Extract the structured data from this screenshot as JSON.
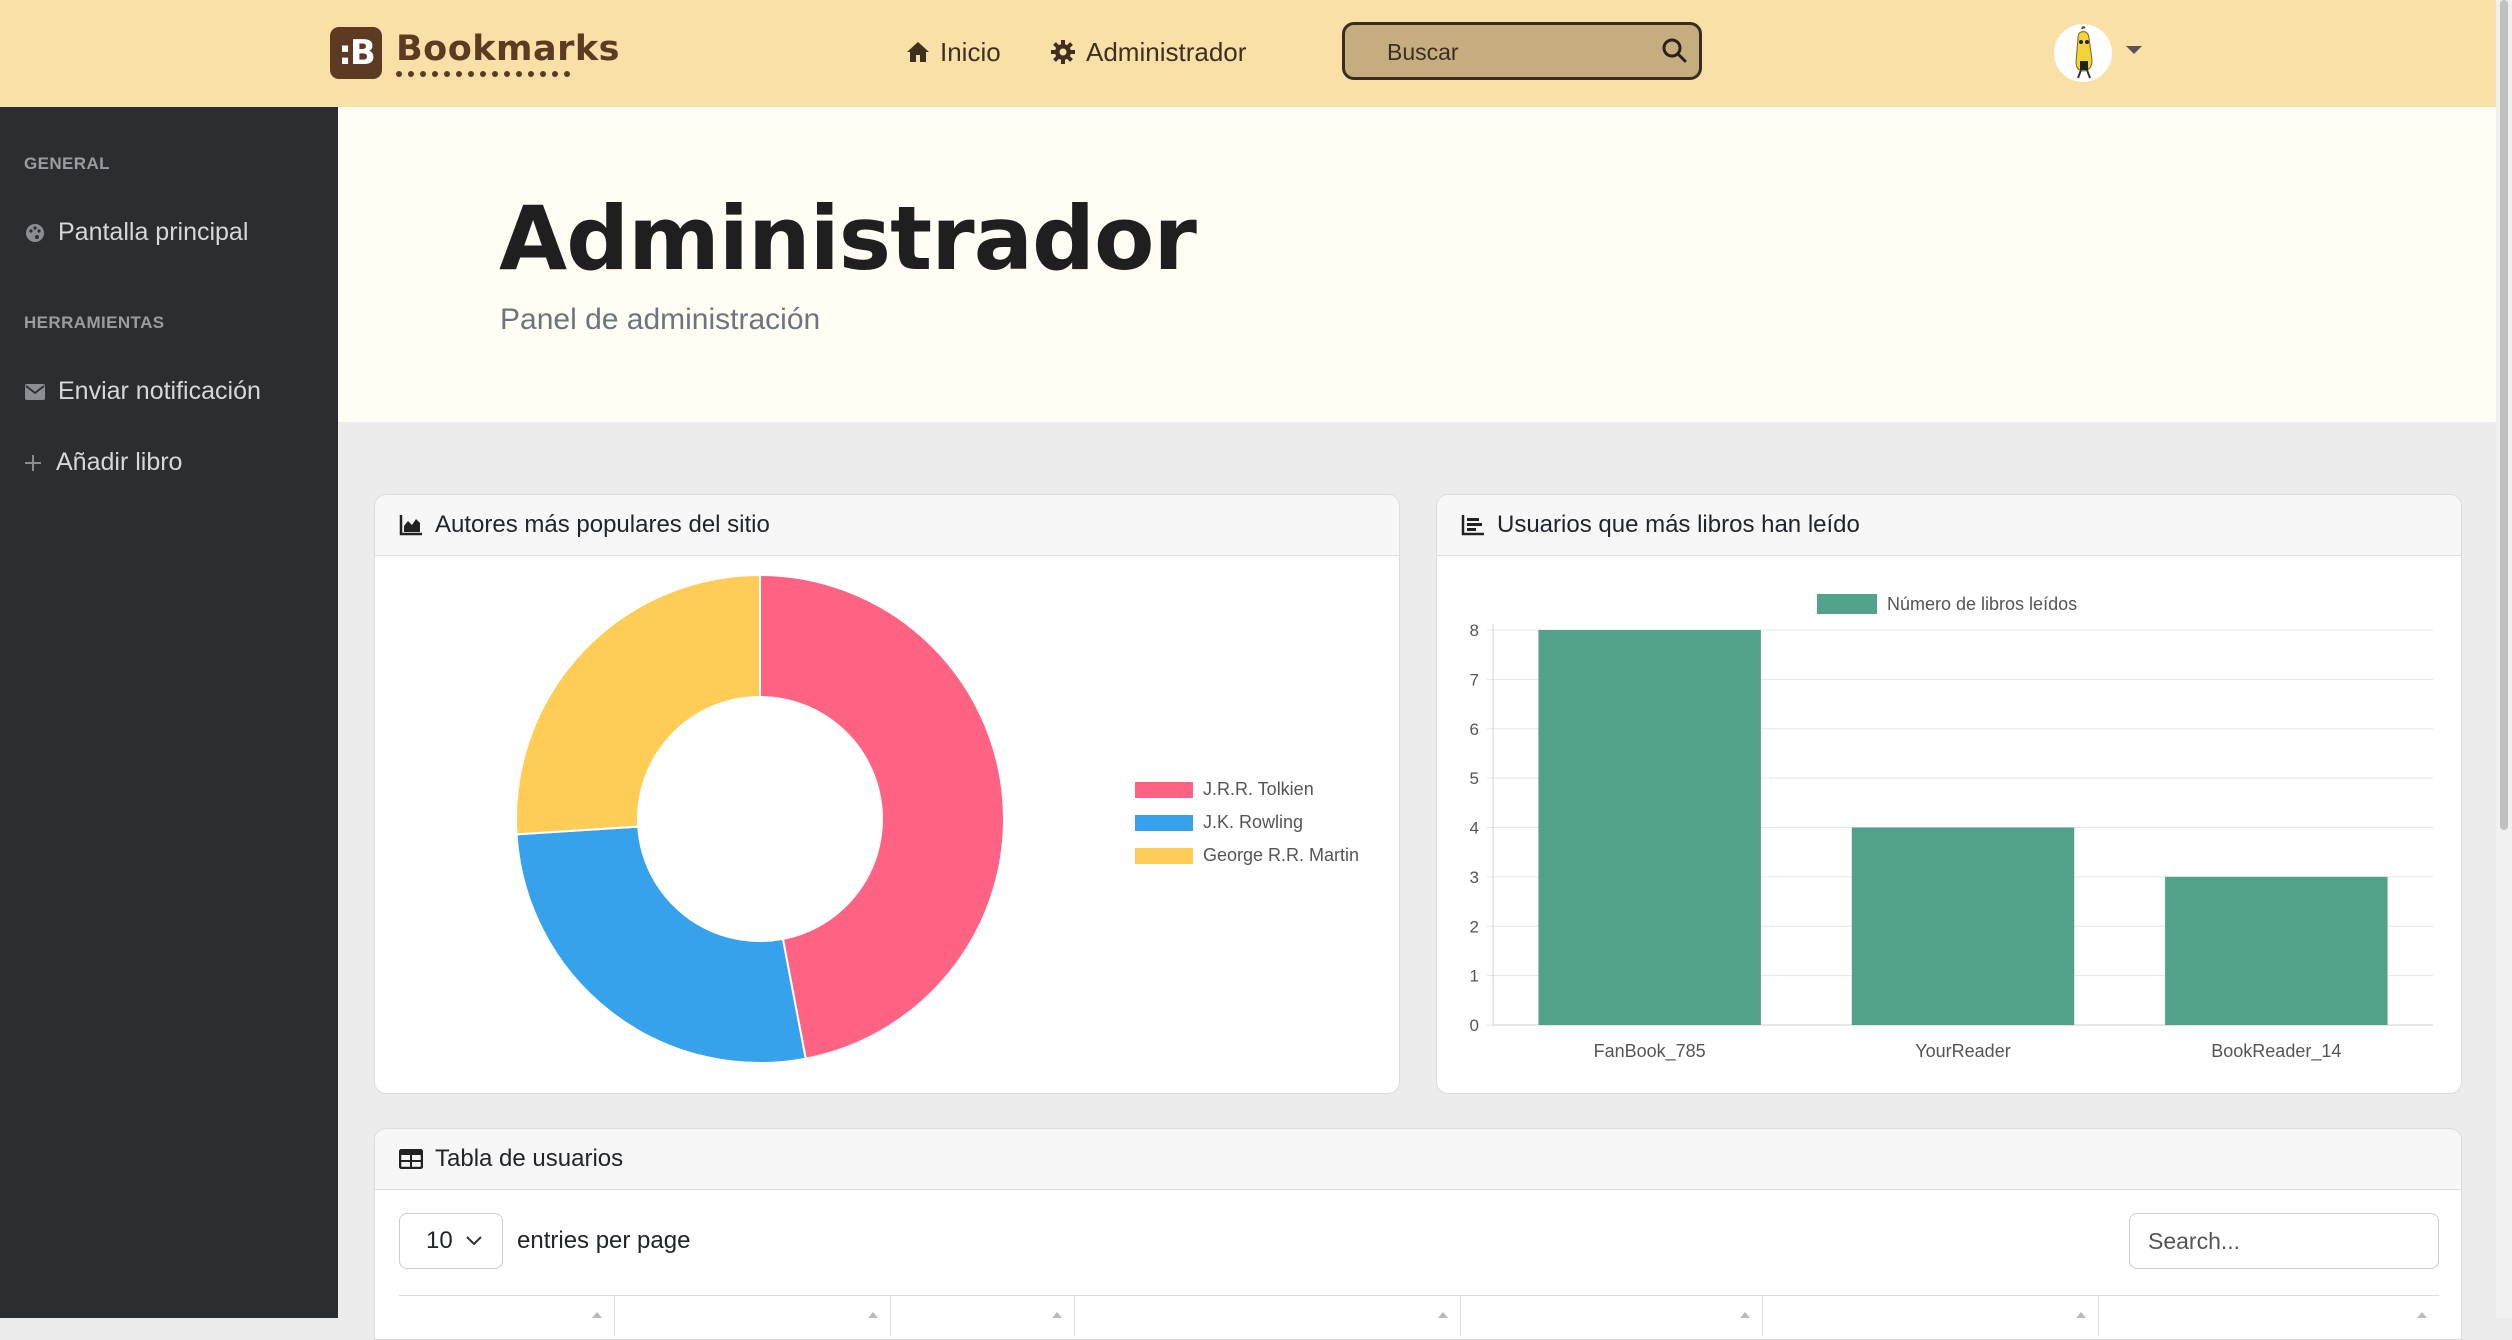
{
  "brand": {
    "name": "Bookmarks",
    "logo_mark": ":B"
  },
  "nav": {
    "home_label": "Inicio",
    "admin_label": "Administrador"
  },
  "search": {
    "placeholder": "Buscar"
  },
  "sidebar": {
    "sections": [
      {
        "heading": "GENERAL",
        "items": [
          {
            "label": "Pantalla principal",
            "icon": "palette-icon"
          }
        ]
      },
      {
        "heading": "HERRAMIENTAS",
        "items": [
          {
            "label": "Enviar notificación",
            "icon": "envelope-icon"
          },
          {
            "label": "Añadir libro",
            "icon": "plus-icon"
          }
        ]
      }
    ]
  },
  "hero": {
    "title": "Administrador",
    "subtitle": "Panel de administración"
  },
  "cards": {
    "authors_title": "Autores más populares del sitio",
    "readers_title": "Usuarios que más libros han leído",
    "table_title": "Tabla de usuarios"
  },
  "table": {
    "entries_value": "10",
    "entries_label": "entries per page",
    "search_placeholder": "Search..."
  },
  "colors": {
    "topbar": "#f9e0a6",
    "sidebar": "#2b2d31",
    "tolkien": "#ff6384",
    "rowling": "#36a2eb",
    "martin": "#ffcd56",
    "bar": "#52a18a"
  },
  "chart_data": [
    {
      "type": "pie",
      "title": "",
      "categories": [
        "J.R.R. Tolkien",
        "J.K. Rowling",
        "George R.R. Martin"
      ],
      "values": [
        47,
        27,
        26
      ],
      "colors": [
        "#ff6384",
        "#36a2eb",
        "#ffcd56"
      ],
      "legend": "right"
    },
    {
      "type": "bar",
      "title": "",
      "categories": [
        "FanBook_785",
        "YourReader",
        "BookReader_14"
      ],
      "series": [
        {
          "name": "Número de libros leídos",
          "values": [
            8,
            4,
            3
          ],
          "color": "#52a18a"
        }
      ],
      "ylim": [
        0,
        8
      ],
      "yticks": [
        "0",
        "1",
        "2",
        "3",
        "4",
        "5",
        "6",
        "7",
        "8"
      ],
      "grid": true,
      "legend": "top"
    }
  ]
}
